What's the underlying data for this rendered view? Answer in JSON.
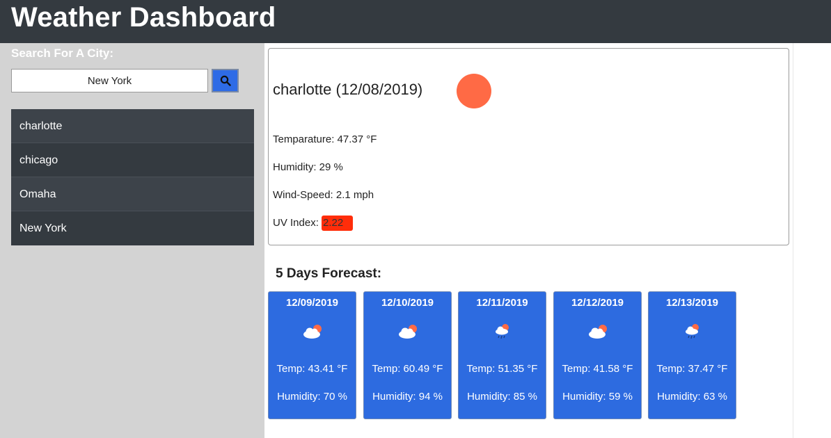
{
  "header": {
    "title": "Weather Dashboard"
  },
  "search": {
    "label": "Search For A City:",
    "value": "New York",
    "button_icon": "search-icon"
  },
  "history": [
    "charlotte",
    "chicago",
    "Omaha",
    "New York"
  ],
  "current": {
    "title": "charlotte (12/08/2019)",
    "icon": "sun-icon",
    "temperature": "Temparature: 47.37 °F",
    "humidity": "Humidity: 29 %",
    "wind": "Wind-Speed: 2.1 mph",
    "uv_label": "UV Index: ",
    "uv_value": "2.22",
    "uv_color": "#ff2d0a"
  },
  "forecast": {
    "title": "5 Days Forecast:",
    "days": [
      {
        "date": "12/09/2019",
        "icon": "cloud-sun-icon",
        "temp": "Temp: 43.41 °F",
        "humidity": "Humidity: 70 %"
      },
      {
        "date": "12/10/2019",
        "icon": "cloud-sun-icon",
        "temp": "Temp: 60.49 °F",
        "humidity": "Humidity: 94 %"
      },
      {
        "date": "12/11/2019",
        "icon": "cloud-rain-sun-icon",
        "temp": "Temp: 51.35 °F",
        "humidity": "Humidity: 85 %"
      },
      {
        "date": "12/12/2019",
        "icon": "cloud-sun-icon",
        "temp": "Temp: 41.58 °F",
        "humidity": "Humidity: 59 %"
      },
      {
        "date": "12/13/2019",
        "icon": "cloud-rain-sun-icon",
        "temp": "Temp: 37.47 °F",
        "humidity": "Humidity: 63 %"
      }
    ]
  },
  "colors": {
    "header_bg": "#343a40",
    "sidebar_bg": "#d3d3d3",
    "card_blue": "#2d6be0",
    "sun": "#ff6a45"
  }
}
